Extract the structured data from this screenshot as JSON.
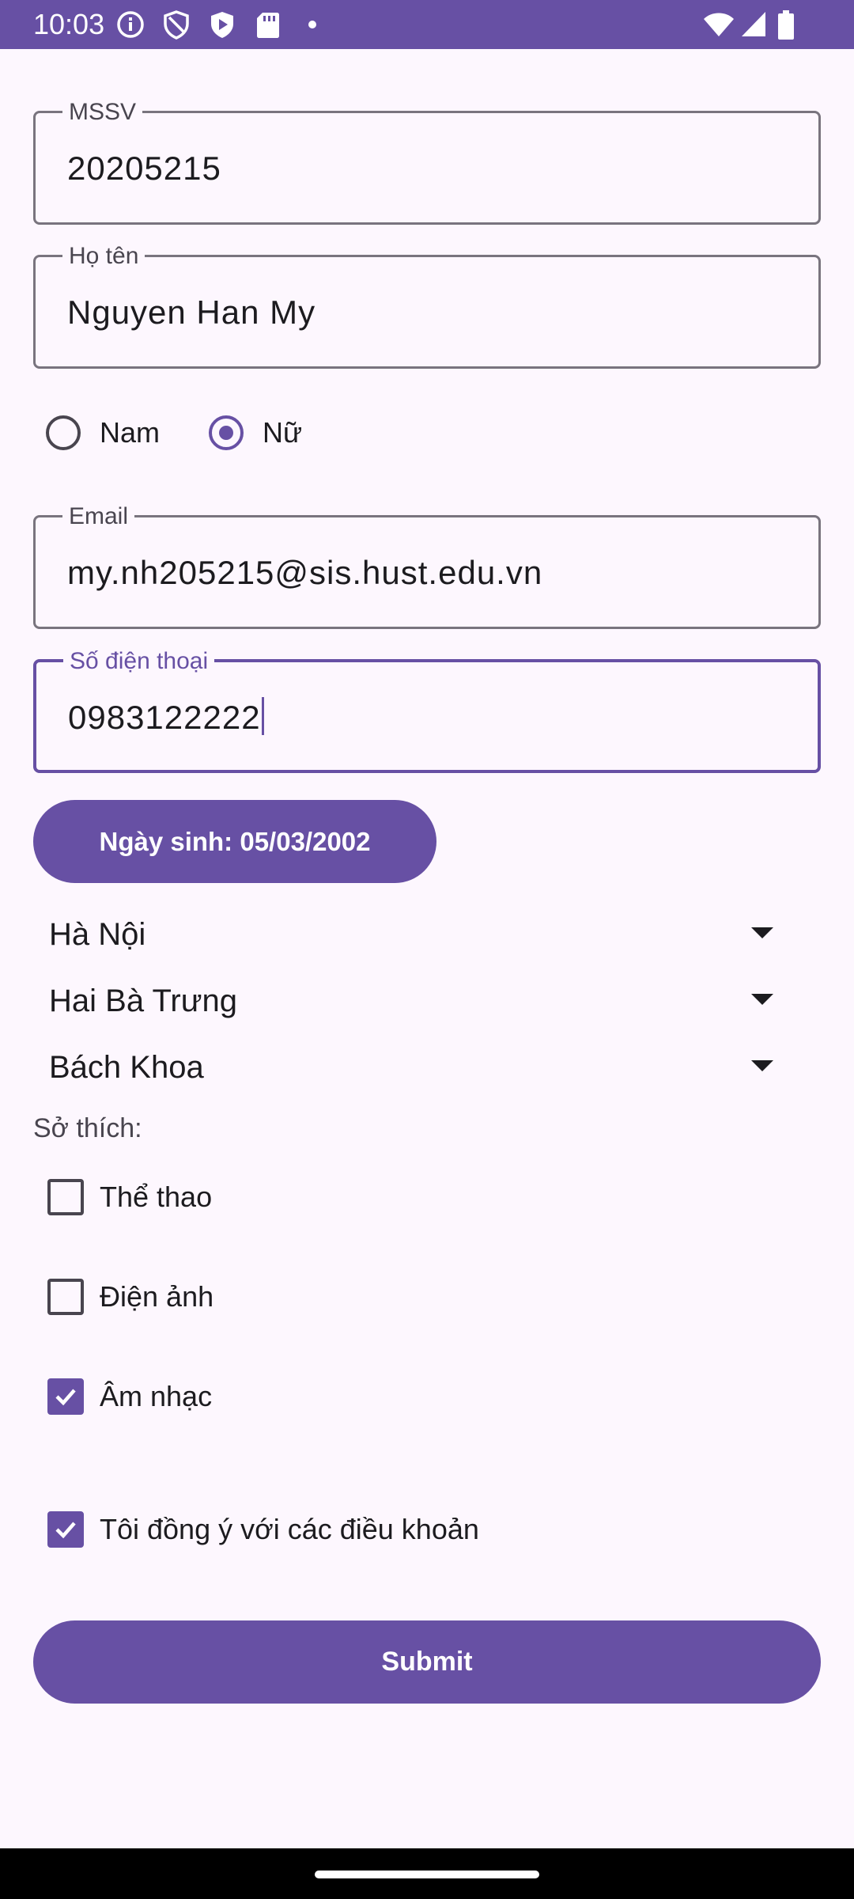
{
  "status_bar": {
    "time": "10:03",
    "left_icons": [
      "info-icon",
      "shield-icon",
      "play-protect-icon",
      "sd-card-icon",
      "dot-icon"
    ],
    "right_icons": [
      "wifi-icon",
      "signal-icon",
      "battery-icon"
    ]
  },
  "form": {
    "mssv": {
      "label": "MSSV",
      "value": "20205215"
    },
    "name": {
      "label": "Họ tên",
      "value": "Nguyen Han My"
    },
    "gender": {
      "options": [
        {
          "label": "Nam",
          "checked": false
        },
        {
          "label": "Nữ",
          "checked": true
        }
      ]
    },
    "email": {
      "label": "Email",
      "value": "my.nh205215@sis.hust.edu.vn"
    },
    "phone": {
      "label": "Số điện thoại",
      "value": "0983122222",
      "focused": true
    },
    "birthday_button": "Ngày sinh: 05/03/2002",
    "dropdowns": [
      {
        "value": "Hà Nội"
      },
      {
        "value": "Hai Bà Trưng"
      },
      {
        "value": "Bách Khoa"
      }
    ],
    "hobbies_label": "Sở thích:",
    "hobbies": [
      {
        "label": "Thể thao",
        "checked": false
      },
      {
        "label": "Điện ảnh",
        "checked": false
      },
      {
        "label": "Âm nhạc",
        "checked": true
      }
    ],
    "terms": {
      "label": "Tôi đồng ý với các điều khoản",
      "checked": true
    },
    "submit_label": "Submit"
  },
  "colors": {
    "primary": "#6750a4",
    "background": "#fdf7fe",
    "outline": "#79747e",
    "text": "#1c1b1f"
  }
}
